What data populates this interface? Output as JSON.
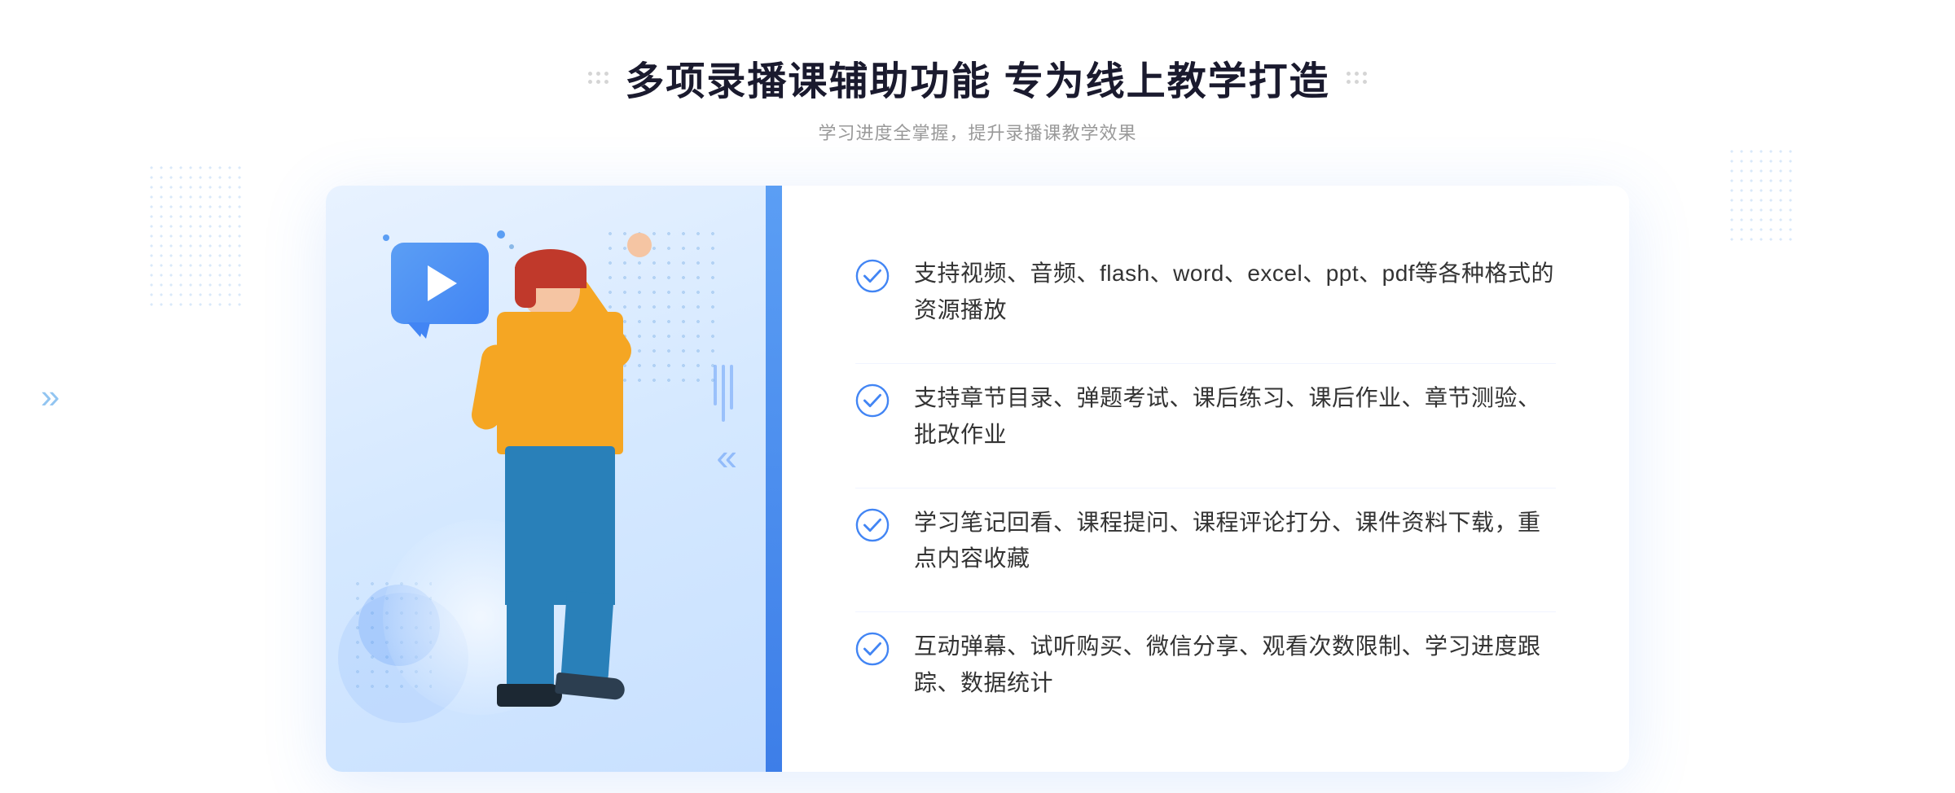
{
  "page": {
    "background_color": "#ffffff"
  },
  "header": {
    "title": "多项录播课辅助功能 专为线上教学打造",
    "subtitle": "学习进度全掌握，提升录播课教学效果",
    "decorative_dots_count": 6
  },
  "features": [
    {
      "id": 1,
      "text": "支持视频、音频、flash、word、excel、ppt、pdf等各种格式的资源播放"
    },
    {
      "id": 2,
      "text": "支持章节目录、弹题考试、课后练习、课后作业、章节测验、批改作业"
    },
    {
      "id": 3,
      "text": "学习笔记回看、课程提问、课程评论打分、课件资料下载，重点内容收藏"
    },
    {
      "id": 4,
      "text": "互动弹幕、试听购买、微信分享、观看次数限制、学习进度跟踪、数据统计"
    }
  ],
  "icons": {
    "check_circle": "✓",
    "play": "▶",
    "chevron_double": "»"
  },
  "colors": {
    "primary_blue": "#4285f4",
    "light_blue": "#5b9ef4",
    "text_dark": "#333333",
    "text_gray": "#999999",
    "bg_blue_light": "#e8f2ff"
  }
}
